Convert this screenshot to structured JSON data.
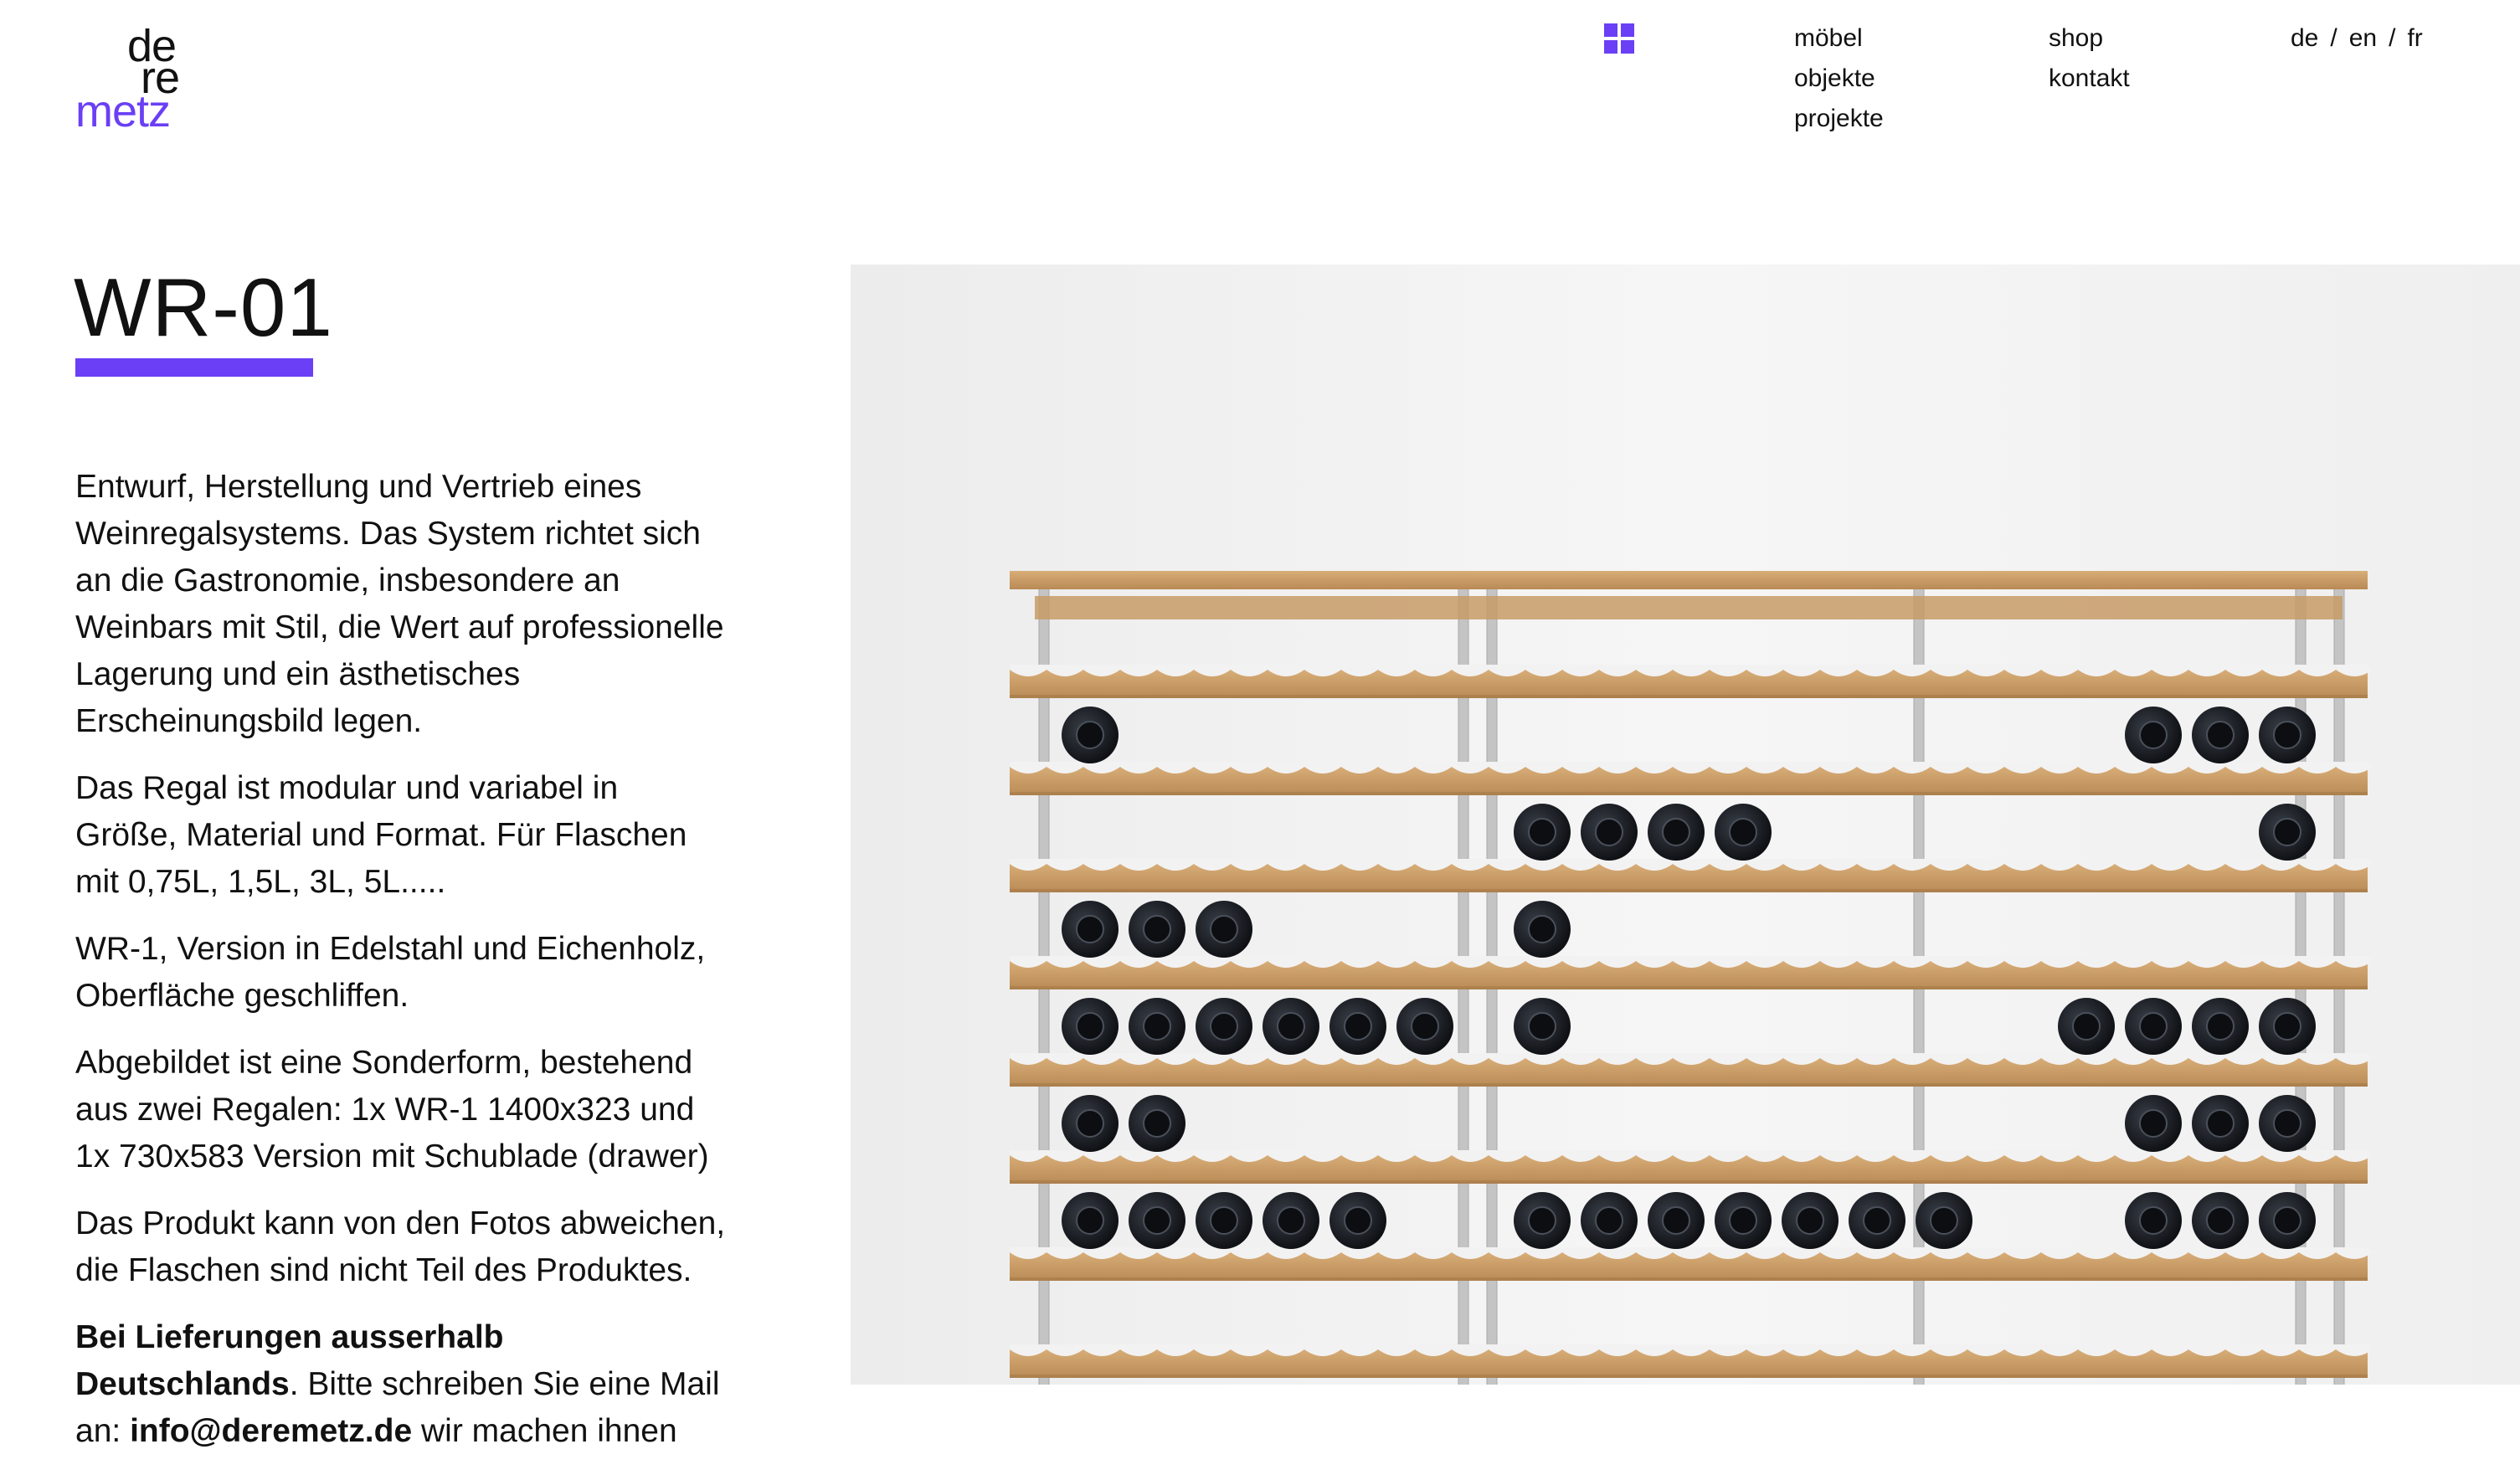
{
  "theme": {
    "accent": "#6a3ff5",
    "wood": "#c89a63",
    "steel": "#c9c9c9",
    "bottle": "#1b1e24"
  },
  "header": {
    "logo": {
      "line1": "de",
      "line2": "re",
      "line3": "metz"
    },
    "grid_icon": "grid-icon",
    "nav_col1": [
      "möbel",
      "objekte",
      "projekte"
    ],
    "nav_col2": [
      "shop",
      "kontakt"
    ],
    "lang": {
      "de": "de",
      "en": "en",
      "fr": "fr",
      "separator": "/"
    }
  },
  "product": {
    "title": "WR-01",
    "paragraphs": [
      "Entwurf, Herstellung und Vertrieb eines Weinregalsystems. Das System richtet sich an die Gastronomie, insbesondere an Weinbars mit Stil, die Wert auf professionelle Lagerung und ein ästhetisches Erscheinungsbild legen.",
      "Das Regal ist modular und variabel in Größe, Material und Format. Für Flaschen mit 0,75L, 1,5L, 3L, 5L.....",
      "WR-1, Version in Edelstahl und Eichenholz, Oberfläche geschliffen.",
      "Abgebildet ist eine Sonderform, bestehend aus zwei Regalen: 1x WR-1 1400x323 und 1x 730x583 Version mit Schublade (drawer)",
      "Das Produkt kann von den Fotos abweichen, die Flaschen sind nicht Teil des Produktes."
    ],
    "delivery": {
      "bold": "Bei Lieferungen ausserhalb Deutschlands",
      "text": ". Bitte schreiben Sie eine Mail an: ",
      "email": "info@deremetz.de",
      "tail": " wir machen ihnen"
    }
  },
  "photo": {
    "shelf_rows": 8,
    "row1_bottles": [
      1,
      0,
      3
    ],
    "row2_bottles": [
      0,
      4,
      1
    ],
    "row3_bottles": [
      3,
      1,
      0
    ],
    "row4_bottles": [
      6,
      1,
      4
    ],
    "row5_bottles": [
      2,
      0,
      3
    ],
    "row6_bottles": [
      5,
      7,
      3
    ]
  }
}
